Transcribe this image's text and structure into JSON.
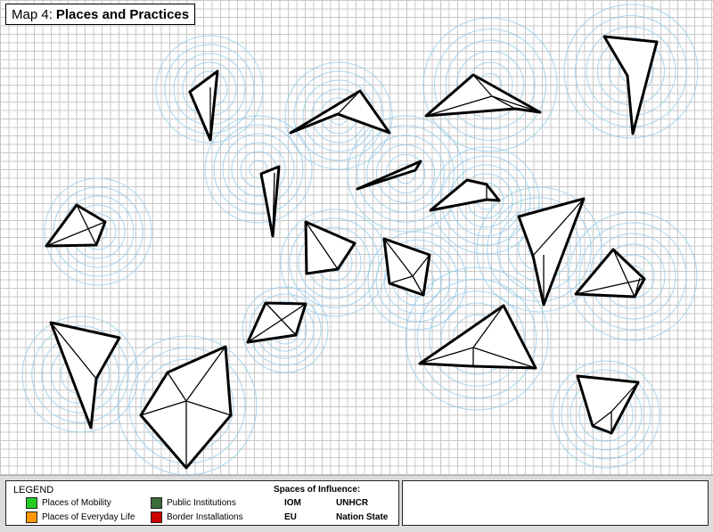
{
  "map": {
    "title_prefix": "Map 4:",
    "title_main": "Places and Practices"
  },
  "legend": {
    "title": "LEGEND",
    "categories": [
      {
        "label": "Places of Mobility",
        "color": "#22cc22"
      },
      {
        "label": "Places of Everyday Life",
        "color": "#ff9900"
      },
      {
        "label": "Public Institutions",
        "color": "#3a6b3a"
      },
      {
        "label": "Border Installations",
        "color": "#cc0000"
      }
    ],
    "spaces_title": "Spaces of Influence:",
    "spaces": [
      "IOM",
      "UNHCR",
      "EU",
      "Nation State"
    ]
  },
  "colors": {
    "grid": "#c8c8c8",
    "influence_ring": "#8ec8ea",
    "shape_fill": "#ffffff",
    "shape_stroke": "#000000"
  }
}
